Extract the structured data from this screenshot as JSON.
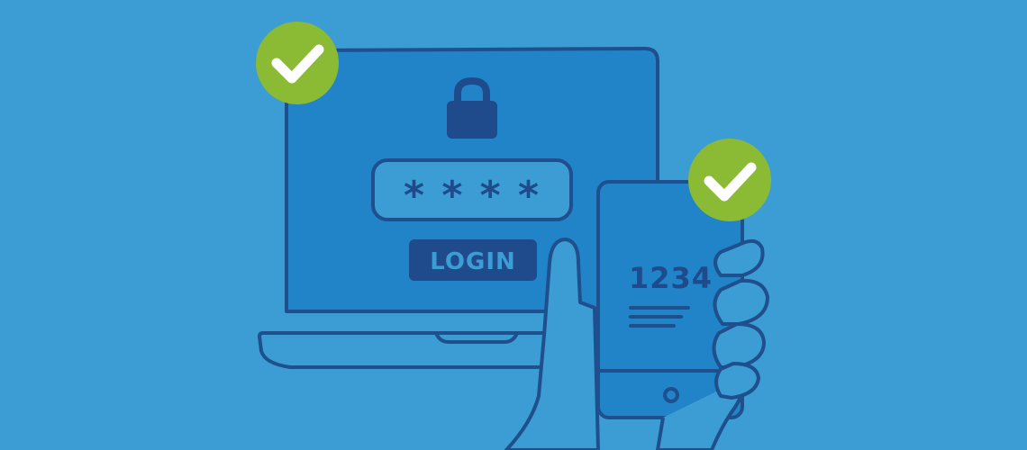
{
  "colors": {
    "background": "#3b9dd4",
    "screen": "#2184c8",
    "outline": "#1f4f8d",
    "dark_navy": "#1f4a8c",
    "check_green": "#8bba34",
    "white": "#ffffff"
  },
  "laptop": {
    "password_mask": "* * * *",
    "login_label": "LOGIN"
  },
  "phone": {
    "code": "1234"
  },
  "icons": {
    "lock": "lock-icon",
    "laptop_check": "checkmark-icon",
    "phone_check": "checkmark-icon",
    "home_button": "home-button-icon"
  }
}
